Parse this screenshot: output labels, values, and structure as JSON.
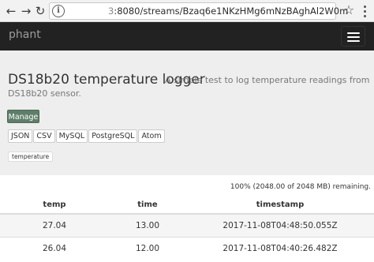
{
  "browser": {
    "url_prefix": "3",
    "url_rest": ":8080/streams/Bzaq6e1NKzHMg6mNzBAghAl2W0m",
    "back_icon": "arrow-left-icon",
    "forward_icon": "arrow-right-icon",
    "reload_icon": "reload-icon",
    "info_icon": "info-icon",
    "info_glyph": "i",
    "star_icon": "star-icon",
    "menu_icon": "vertical-dots-icon"
  },
  "navbar": {
    "brand": "phant",
    "toggle_icon": "hamburger-icon"
  },
  "stream": {
    "title": "DS18b20 temperature logger",
    "description_line1": "A simple test to log temperature readings from",
    "description_line2": "DS18b20 sensor.",
    "manage_label": "Manage",
    "formats": [
      "JSON",
      "CSV",
      "MySQL",
      "PostgreSQL",
      "Atom"
    ],
    "tag": "temperature"
  },
  "storage": {
    "remaining_text": "100% (2048.00 of 2048 MB) remaining."
  },
  "table": {
    "headers": [
      "temp",
      "time",
      "timestamp"
    ],
    "rows": [
      [
        "27.04",
        "13.00",
        "2017-11-08T04:48:50.055Z"
      ],
      [
        "26.04",
        "12.00",
        "2017-11-08T04:40:26.482Z"
      ]
    ]
  },
  "colors": {
    "navbar_bg": "#222222",
    "jumbotron_bg": "#eeeeee",
    "manage_button_bg": "#5f7e6a"
  }
}
